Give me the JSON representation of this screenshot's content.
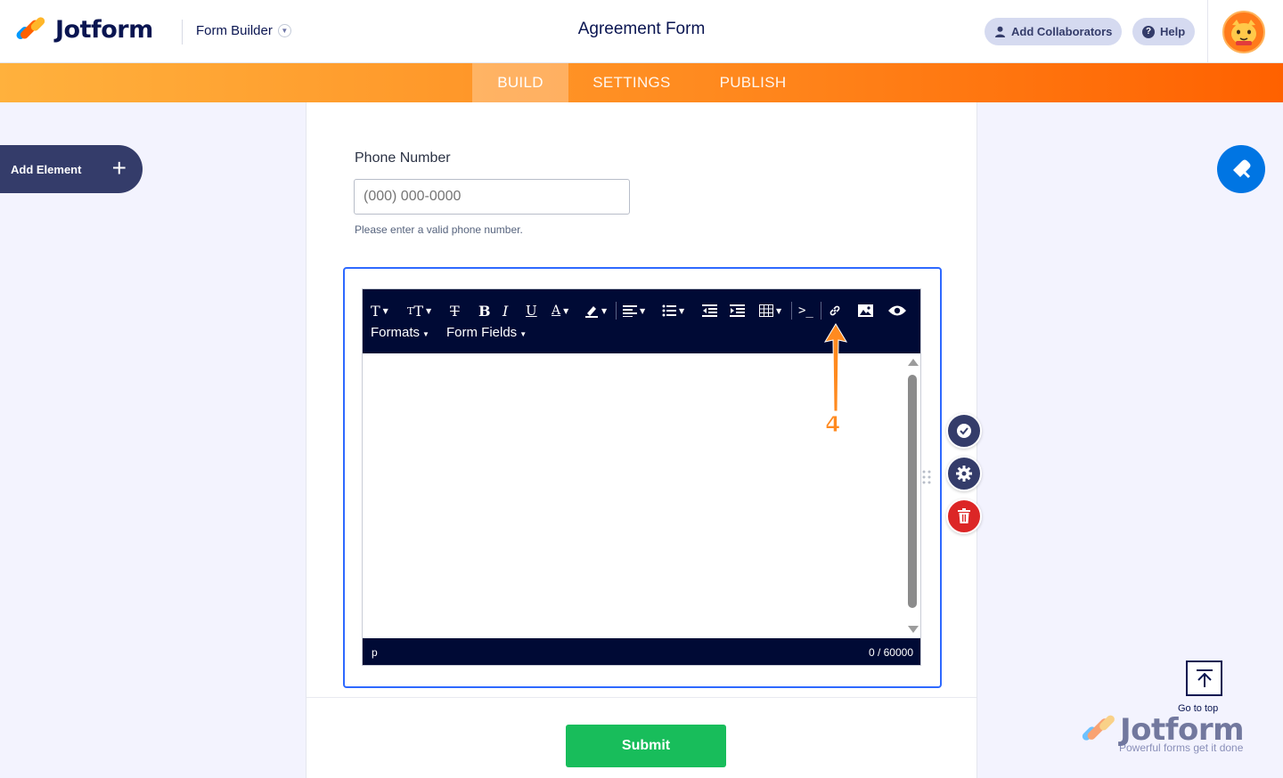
{
  "header": {
    "brand": "Jotform",
    "form_builder_label": "Form Builder",
    "title": "Agreement Form",
    "add_collaborators": "Add Collaborators",
    "help": "Help"
  },
  "tabs": [
    {
      "label": "BUILD",
      "active": true
    },
    {
      "label": "SETTINGS",
      "active": false
    },
    {
      "label": "PUBLISH",
      "active": false
    }
  ],
  "sidebar": {
    "add_element": "Add Element"
  },
  "form": {
    "phone_label": "Phone Number",
    "phone_placeholder": "(000) 000-0000",
    "phone_help": "Please enter a valid phone number.",
    "submit_label": "Submit"
  },
  "editor": {
    "formats_label": "Formats",
    "form_fields_label": "Form Fields",
    "status_path": "p",
    "char_count": "0 / 60000",
    "toolbar_icons": [
      "font-family-icon",
      "font-size-icon",
      "clear-format-icon",
      "bold-icon",
      "italic-icon",
      "underline-icon",
      "text-color-icon",
      "highlight-icon",
      "align-icon",
      "list-icon",
      "outdent-icon",
      "indent-icon",
      "table-icon",
      "code-icon",
      "link-icon",
      "image-icon",
      "preview-icon"
    ]
  },
  "annotation": {
    "step_number": "4",
    "color": "#ff8a1f"
  },
  "right_panel": {
    "go_to_top": "Go to top",
    "footer_brand": "Jotform",
    "footer_tagline": "Powerful forms get it done"
  },
  "colors": {
    "accent_orange": "#ff6100",
    "primary_blue": "#0075e3",
    "selection_blue": "#2e69ff",
    "submit_green": "#18bd5b",
    "delete_red": "#dc2626",
    "navy": "#0a1551"
  }
}
